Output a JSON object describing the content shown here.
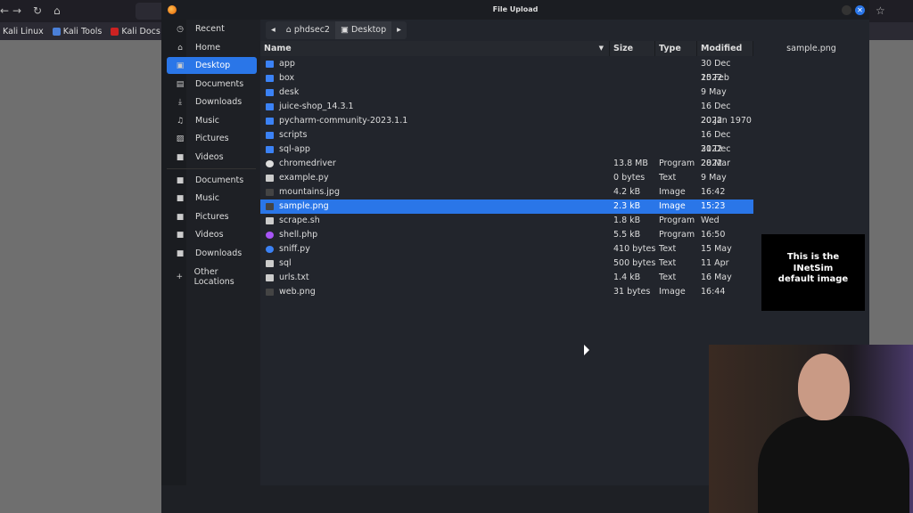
{
  "browser": {
    "bookmarks": [
      "Kali Linux",
      "Kali Tools",
      "Kali Docs"
    ]
  },
  "dialog": {
    "title": "File Upload",
    "sidebar": [
      {
        "icon": "clock-icon",
        "glyph": "◷",
        "label": "Recent"
      },
      {
        "icon": "home-icon",
        "glyph": "⌂",
        "label": "Home"
      },
      {
        "icon": "desktop-icon",
        "glyph": "▣",
        "label": "Desktop",
        "selected": true
      },
      {
        "icon": "document-icon",
        "glyph": "▤",
        "label": "Documents"
      },
      {
        "icon": "download-icon",
        "glyph": "⤓",
        "label": "Downloads"
      },
      {
        "icon": "music-icon",
        "glyph": "♫",
        "label": "Music"
      },
      {
        "icon": "picture-icon",
        "glyph": "▨",
        "label": "Pictures"
      },
      {
        "icon": "video-icon",
        "glyph": "■",
        "label": "Videos"
      },
      {
        "icon": "folder-icon",
        "glyph": "■",
        "label": "Documents"
      },
      {
        "icon": "folder-icon",
        "glyph": "■",
        "label": "Music"
      },
      {
        "icon": "folder-icon",
        "glyph": "■",
        "label": "Pictures"
      },
      {
        "icon": "folder-icon",
        "glyph": "■",
        "label": "Videos"
      },
      {
        "icon": "folder-icon",
        "glyph": "■",
        "label": "Downloads"
      },
      {
        "icon": "plus-icon",
        "glyph": "+",
        "label": "Other Locations"
      }
    ],
    "path": [
      "phdsec2",
      "Desktop"
    ],
    "columns": {
      "name": "Name",
      "size": "Size",
      "type": "Type",
      "modified": "Modified"
    },
    "files": [
      {
        "name": "app",
        "size": "",
        "type": "",
        "modified": "30 Dec 2022",
        "kind": "folder"
      },
      {
        "name": "box",
        "size": "",
        "type": "",
        "modified": "15 Feb",
        "kind": "folder"
      },
      {
        "name": "desk",
        "size": "",
        "type": "",
        "modified": "9 May",
        "kind": "folder"
      },
      {
        "name": "juice-shop_14.3.1",
        "size": "",
        "type": "",
        "modified": "16 Dec 2022",
        "kind": "folder"
      },
      {
        "name": "pycharm-community-2023.1.1",
        "size": "",
        "type": "",
        "modified": "20 Jan 1970",
        "kind": "folder"
      },
      {
        "name": "scripts",
        "size": "",
        "type": "",
        "modified": "16 Dec 2022",
        "kind": "folder"
      },
      {
        "name": "sql-app",
        "size": "",
        "type": "",
        "modified": "31 Dec 2022",
        "kind": "folder"
      },
      {
        "name": "chromedriver",
        "size": "13.8 MB",
        "type": "Program",
        "modified": "28 Mar",
        "kind": "program"
      },
      {
        "name": "example.py",
        "size": "0 bytes",
        "type": "Text",
        "modified": "9 May",
        "kind": "text"
      },
      {
        "name": "mountains.jpg",
        "size": "4.2 kB",
        "type": "Image",
        "modified": "16:42",
        "kind": "image"
      },
      {
        "name": "sample.png",
        "size": "2.3 kB",
        "type": "Image",
        "modified": "15:23",
        "kind": "image",
        "selected": true
      },
      {
        "name": "scrape.sh",
        "size": "1.8 kB",
        "type": "Program",
        "modified": "Wed",
        "kind": "text"
      },
      {
        "name": "shell.php",
        "size": "5.5 kB",
        "type": "Program",
        "modified": "16:50",
        "kind": "php"
      },
      {
        "name": "sniff.py",
        "size": "410 bytes",
        "type": "Text",
        "modified": "15 May",
        "kind": "python"
      },
      {
        "name": "sql",
        "size": "500 bytes",
        "type": "Text",
        "modified": "11 Apr",
        "kind": "text"
      },
      {
        "name": "urls.txt",
        "size": "1.4 kB",
        "type": "Text",
        "modified": "16 May",
        "kind": "text"
      },
      {
        "name": "web.png",
        "size": "31 bytes",
        "type": "Image",
        "modified": "16:44",
        "kind": "image"
      }
    ],
    "preview": {
      "filename": "sample.png",
      "image_text": [
        "This is the",
        "INetSim",
        "default image"
      ]
    }
  },
  "colors": {
    "accent": "#2a76e8",
    "folder": "#3b82f6"
  }
}
